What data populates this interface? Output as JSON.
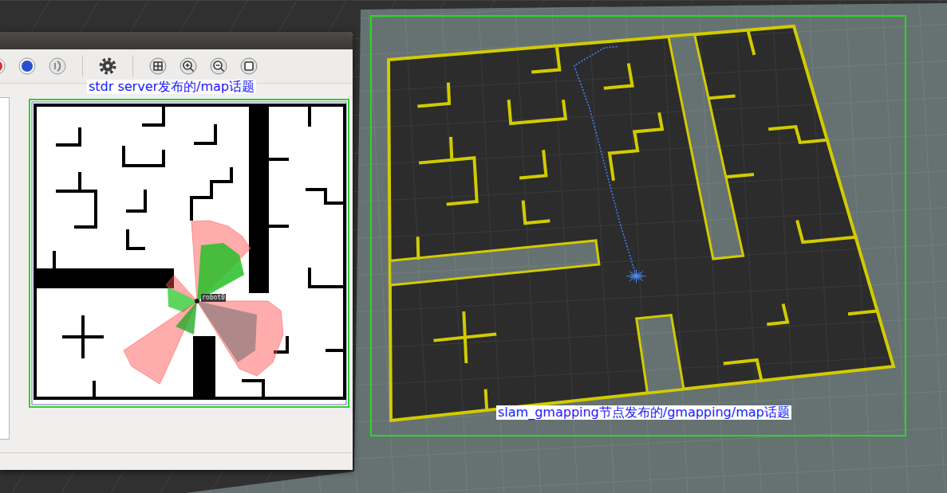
{
  "stdr_gui": {
    "map_label": "stdr server发布的/map话题",
    "robot_label": "robot0"
  },
  "rviz": {
    "map_label": "slam_gmapping节点发布的/gmapping/map话题"
  }
}
